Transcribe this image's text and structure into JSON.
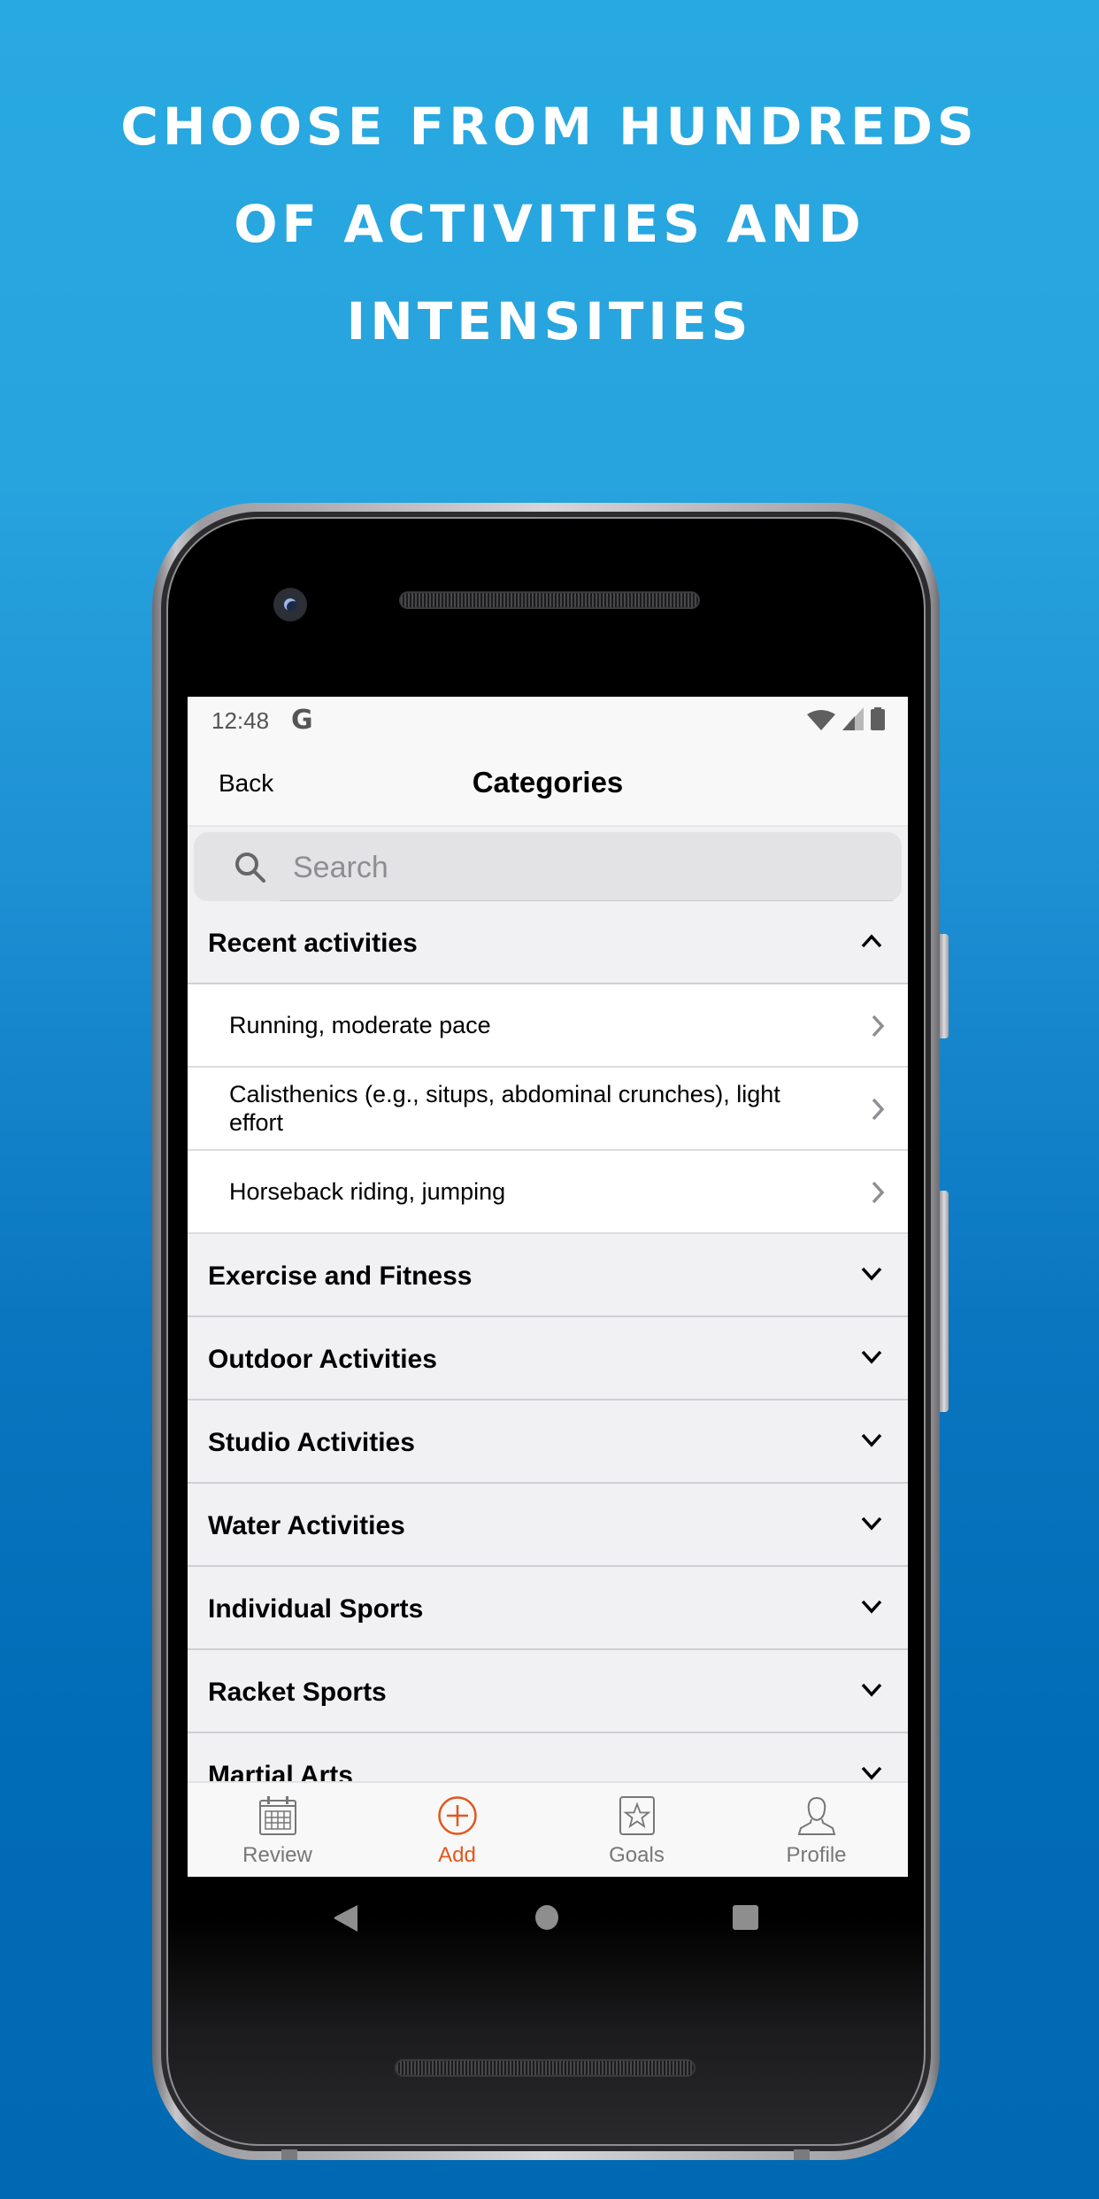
{
  "promo": {
    "headline_lines": [
      "CHOOSE FROM HUNDREDS",
      "OF ACTIVITIES AND",
      "INTENSITIES"
    ]
  },
  "status_bar": {
    "time": "12:48",
    "notification_icon": "google-g-icon",
    "icons": [
      "wifi-icon",
      "cell-signal-icon",
      "battery-icon"
    ]
  },
  "nav": {
    "back_label": "Back",
    "title": "Categories"
  },
  "search": {
    "placeholder": "Search",
    "value": ""
  },
  "sections": [
    {
      "title": "Recent activities",
      "expanded": true,
      "items": [
        "Running, moderate pace",
        "Calisthenics (e.g., situps, abdominal crunches), light effort",
        "Horseback riding, jumping"
      ]
    },
    {
      "title": "Exercise and Fitness",
      "expanded": false
    },
    {
      "title": "Outdoor Activities",
      "expanded": false
    },
    {
      "title": "Studio Activities",
      "expanded": false
    },
    {
      "title": "Water Activities",
      "expanded": false
    },
    {
      "title": "Individual Sports",
      "expanded": false
    },
    {
      "title": "Racket Sports",
      "expanded": false
    },
    {
      "title": "Martial Arts",
      "expanded": false
    }
  ],
  "tabs": [
    {
      "label": "Review",
      "icon": "calendar-icon",
      "active": false
    },
    {
      "label": "Add",
      "icon": "plus-circle-icon",
      "active": true
    },
    {
      "label": "Goals",
      "icon": "star-card-icon",
      "active": false
    },
    {
      "label": "Profile",
      "icon": "person-icon",
      "active": false
    }
  ],
  "system_nav": [
    "back-triangle-icon",
    "home-circle-icon",
    "recents-square-icon"
  ],
  "colors": {
    "accent": "#e2571c",
    "inactive_tab": "#777777",
    "background_top": "#29a9e1",
    "background_bottom": "#0069b4"
  }
}
